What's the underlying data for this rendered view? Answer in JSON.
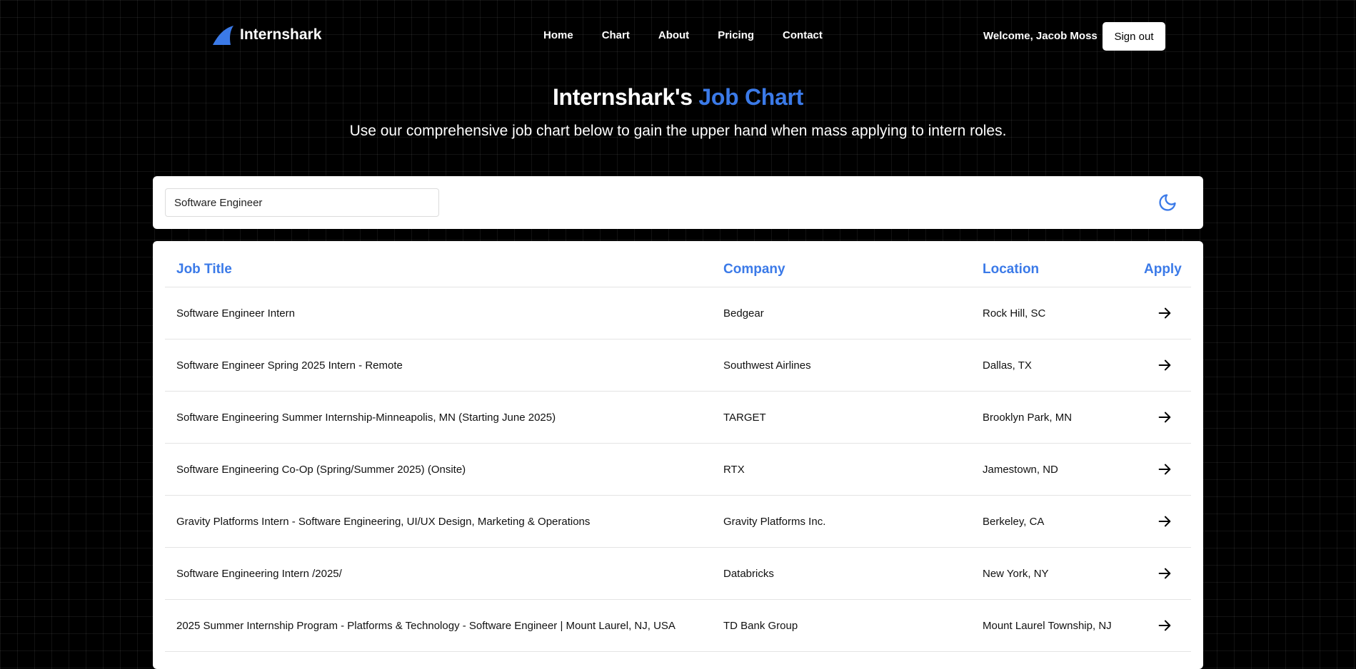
{
  "nav": {
    "brand": "Internshark",
    "links": [
      "Home",
      "Chart",
      "About",
      "Pricing",
      "Contact"
    ],
    "welcome": "Welcome, Jacob Moss",
    "signout_label": "Sign out"
  },
  "hero": {
    "title_main": "Internshark's",
    "title_accent": "Job Chart",
    "subtitle": "Use our comprehensive job chart below to gain the upper hand when mass applying to intern roles."
  },
  "search": {
    "value": "Software Engineer",
    "theme_icon": "moon-icon"
  },
  "table": {
    "headers": {
      "job_title": "Job Title",
      "company": "Company",
      "location": "Location",
      "apply": "Apply"
    },
    "rows": [
      {
        "title": "Software Engineer Intern",
        "company": "Bedgear",
        "location": "Rock Hill, SC"
      },
      {
        "title": "Software Engineer Spring 2025 Intern - Remote",
        "company": "Southwest Airlines",
        "location": "Dallas, TX"
      },
      {
        "title": "Software Engineering Summer Internship-Minneapolis, MN (Starting June 2025)",
        "company": "TARGET",
        "location": "Brooklyn Park, MN"
      },
      {
        "title": "Software Engineering Co-Op (Spring/Summer 2025) (Onsite)",
        "company": "RTX",
        "location": "Jamestown, ND"
      },
      {
        "title": "Gravity Platforms Intern - Software Engineering, UI/UX Design, Marketing & Operations",
        "company": "Gravity Platforms Inc.",
        "location": "Berkeley, CA"
      },
      {
        "title": "Software Engineering Intern /2025/",
        "company": "Databricks",
        "location": "New York, NY"
      },
      {
        "title": "2025 Summer Internship Program - Platforms & Technology - Software Engineer | Mount Laurel, NJ, USA",
        "company": "TD Bank Group",
        "location": "Mount Laurel Township, NJ"
      }
    ]
  },
  "colors": {
    "accent": "#3b7ae8",
    "background": "#000000",
    "card": "#ffffff"
  }
}
